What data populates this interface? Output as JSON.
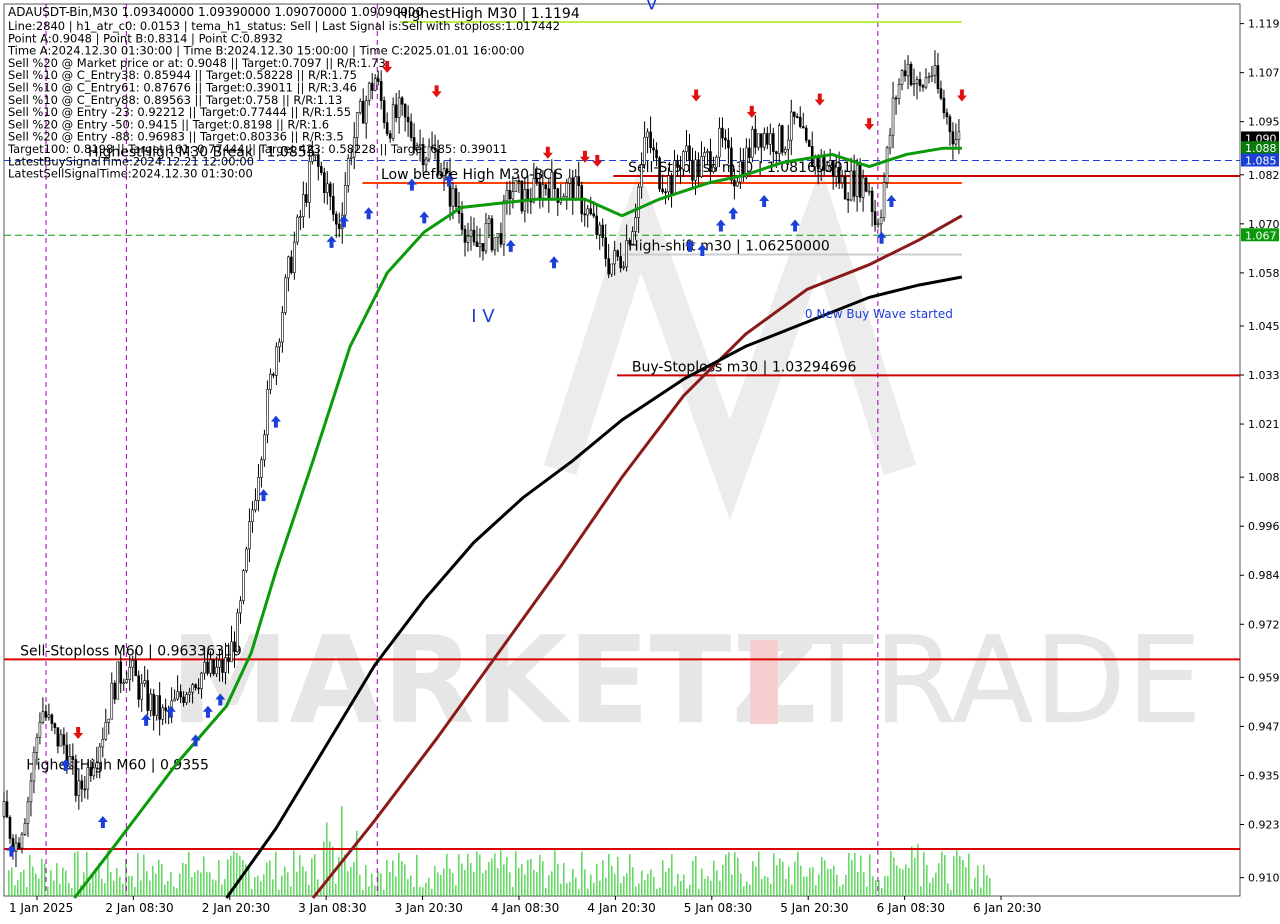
{
  "chart_data": {
    "type": "candlestick",
    "symbol_line": "ADAUSDT-Bin,M30  1.09340000 1.09390000 1.09070000 1.09090000",
    "info_lines": [
      "Line:2840 | h1_atr_c0: 0.0153 | tema_h1_status: Sell | Last Signal is:Sell with stoploss:1.017442",
      "Point A:0.9048 | Point B:0.8314 | Point C:0.8932",
      "Time A:2024.12.30 01:30:00 | Time B:2024.12.30 15:00:00 | Time C:2025.01.01 16:00:00",
      "Sell %20 @ Market price or at: 0.9048 || Target:0.7097 || R/R:1.73",
      "Sell %10 @ C_Entry38: 0.85944 || Target:0.58228 || R/R:1.75",
      "Sell %10 @ C_Entry61: 0.87676 || Target:0.39011 || R/R:3.46",
      "Sell %10 @ C_Entry88: 0.89563 || Target:0.758 || R/R:1.13",
      "Sell %10 @ Entry -23: 0.92212 || Target:0.77444 || R/R:1.55",
      "Sell %20 @ Entry -50: 0.9415 || Target:0.8198 || R/R:1.6",
      "Sell %20 @ Entry -88: 0.96983 || Target:0.80336 || R/R:3.5",
      "Target100: 0.8198 || Target 161: 0.77444 || Target 423: 0.58228 || Target 685: 0.39011",
      "LatestBuySignalTime:2024.12.21 12:00:00",
      "LatestSellSignalTime:2024.12.30 01:30:00"
    ],
    "y_axis": {
      "ticks": [
        "1.119",
        "1.107",
        "1.095",
        "1.082",
        "1.070",
        "1.058",
        "1.045",
        "1.033",
        "1.021",
        "1.008",
        "0.996",
        "0.984",
        "0.972",
        "0.959",
        "0.947",
        "0.935",
        "0.923",
        "0.910"
      ],
      "range": [
        0.9055,
        1.1238
      ]
    },
    "x_axis": {
      "ticks": [
        "1 Jan 2025",
        "2 Jan 08:30",
        "2 Jan 20:30",
        "3 Jan 08:30",
        "3 Jan 20:30",
        "4 Jan 08:30",
        "4 Jan 20:30",
        "5 Jan 08:30",
        "5 Jan 20:30",
        "6 Jan 08:30",
        "6 Jan 20:30"
      ]
    },
    "price_tags": [
      {
        "value": 1.0909,
        "text": "1.090",
        "bg": "#000000"
      },
      {
        "value": 1.0885,
        "text": "1.088",
        "bg": "#0a7a0a"
      },
      {
        "value": 1.0855,
        "text": "1.085",
        "bg": "#1c3fd8"
      },
      {
        "value": 1.0672,
        "text": "1.067",
        "bg": "#0a9a0a"
      }
    ],
    "levels": [
      {
        "label": "HighestHigh   M30 | 1.1194",
        "value": 1.1194,
        "color": "#b8f040",
        "x0": 0.32,
        "x1": 0.775,
        "label_x": 0.318
      },
      {
        "label": "Sell-Stoploss m30 | 1.08165301",
        "value": 1.0817,
        "color": "#cc0000",
        "x0": 0.493,
        "x1": 1.0,
        "label_x": 0.505
      },
      {
        "label": "Low before High   M30-BOS",
        "value": 1.08,
        "color": "#ff4000",
        "x0": 0.29,
        "x1": 0.775,
        "label_x": 0.305
      },
      {
        "label": "High-shift m30 | 1.06250000",
        "value": 1.0625,
        "color": "#cccccc",
        "x0": 0.5,
        "x1": 0.775,
        "label_x": 0.505
      },
      {
        "label": "Buy-Stoploss m30 | 1.03294696",
        "value": 1.0329,
        "color": "#cc0000",
        "x0": 0.496,
        "x1": 1.0,
        "label_x": 0.508
      },
      {
        "label": "Sell-Stoploss M60 | 0.96336319",
        "value": 0.9634,
        "color": "#dd0000",
        "x0": 0.0,
        "x1": 1.0,
        "label_x": 0.013
      },
      {
        "label": "HighestHigh   M60 | 0.9355",
        "value": 0.9355,
        "color": "#cccccc",
        "x0": 0.0,
        "x1": 0.0,
        "label_x": 0.018
      },
      {
        "label": "",
        "value": 0.917,
        "color": "#dd0000",
        "x0": 0.0,
        "x1": 1.0,
        "label_x": 0
      },
      {
        "label": "",
        "value": 1.0855,
        "color": "#1c3fd8",
        "x0": 0.0,
        "x1": 1.0,
        "label_x": 0,
        "dash": true
      },
      {
        "label": "",
        "value": 1.0672,
        "color": "#0a9a0a",
        "x0": 0.0,
        "x1": 1.0,
        "label_x": 0,
        "dash": true
      },
      {
        "label": "HighestHigh M30 Break | 1.0855",
        "value": 1.0855,
        "color": "#1c3fd8",
        "x0": 0.0,
        "x1": 0.0,
        "label_x": 0.068
      }
    ],
    "wave_labels": [
      {
        "text": "V",
        "t": 0.519,
        "value": 1.1225,
        "color": "#1c3fd8"
      },
      {
        "text": "I V",
        "t": 0.378,
        "value": 1.046,
        "color": "#1c3fd8"
      }
    ],
    "annotations": [
      {
        "text": "0 New Buy Wave started",
        "t": 0.648,
        "value": 1.047,
        "color": "#1c3fd8"
      }
    ],
    "watermark": [
      "MARKETZ",
      "I",
      "TRADE"
    ],
    "series": [
      {
        "name": "ema_fast",
        "color": "#0a9a0a",
        "points": [
          [
            0.057,
            0.905
          ],
          [
            0.09,
            0.918
          ],
          [
            0.14,
            0.938
          ],
          [
            0.18,
            0.952
          ],
          [
            0.2,
            0.965
          ],
          [
            0.22,
            0.985
          ],
          [
            0.25,
            1.012
          ],
          [
            0.28,
            1.04
          ],
          [
            0.31,
            1.058
          ],
          [
            0.34,
            1.068
          ],
          [
            0.37,
            1.074
          ],
          [
            0.4,
            1.075
          ],
          [
            0.43,
            1.076
          ],
          [
            0.47,
            1.076
          ],
          [
            0.5,
            1.072
          ],
          [
            0.53,
            1.076
          ],
          [
            0.57,
            1.08
          ],
          [
            0.6,
            1.082
          ],
          [
            0.63,
            1.085
          ],
          [
            0.67,
            1.087
          ],
          [
            0.7,
            1.084
          ],
          [
            0.73,
            1.087
          ],
          [
            0.76,
            1.0885
          ],
          [
            0.775,
            1.0885
          ]
        ]
      },
      {
        "name": "ma_slow",
        "color": "#8b1a1a",
        "points": [
          [
            0.25,
            0.905
          ],
          [
            0.3,
            0.924
          ],
          [
            0.35,
            0.944
          ],
          [
            0.4,
            0.965
          ],
          [
            0.45,
            0.986
          ],
          [
            0.5,
            1.008
          ],
          [
            0.55,
            1.028
          ],
          [
            0.6,
            1.043
          ],
          [
            0.65,
            1.054
          ],
          [
            0.7,
            1.06
          ],
          [
            0.74,
            1.066
          ],
          [
            0.775,
            1.072
          ]
        ]
      },
      {
        "name": "ma_black",
        "color": "#000000",
        "points": [
          [
            0.18,
            0.905
          ],
          [
            0.22,
            0.922
          ],
          [
            0.26,
            0.942
          ],
          [
            0.3,
            0.962
          ],
          [
            0.34,
            0.978
          ],
          [
            0.38,
            0.992
          ],
          [
            0.42,
            1.003
          ],
          [
            0.46,
            1.012
          ],
          [
            0.5,
            1.022
          ],
          [
            0.55,
            1.032
          ],
          [
            0.6,
            1.04
          ],
          [
            0.65,
            1.046
          ],
          [
            0.7,
            1.052
          ],
          [
            0.74,
            1.055
          ],
          [
            0.775,
            1.057
          ]
        ]
      }
    ],
    "price_path": [
      [
        0.0,
        0.925
      ],
      [
        0.01,
        0.918
      ],
      [
        0.02,
        0.93
      ],
      [
        0.03,
        0.952
      ],
      [
        0.04,
        0.945
      ],
      [
        0.05,
        0.942
      ],
      [
        0.06,
        0.93
      ],
      [
        0.07,
        0.938
      ],
      [
        0.08,
        0.946
      ],
      [
        0.09,
        0.958
      ],
      [
        0.1,
        0.962
      ],
      [
        0.11,
        0.956
      ],
      [
        0.12,
        0.952
      ],
      [
        0.13,
        0.949
      ],
      [
        0.14,
        0.953
      ],
      [
        0.15,
        0.958
      ],
      [
        0.16,
        0.96
      ],
      [
        0.17,
        0.96
      ],
      [
        0.18,
        0.962
      ],
      [
        0.19,
        0.972
      ],
      [
        0.2,
        0.998
      ],
      [
        0.21,
        1.02
      ],
      [
        0.22,
        1.04
      ],
      [
        0.23,
        1.058
      ],
      [
        0.24,
        1.072
      ],
      [
        0.25,
        1.086
      ],
      [
        0.26,
        1.08
      ],
      [
        0.27,
        1.068
      ],
      [
        0.28,
        1.088
      ],
      [
        0.29,
        1.098
      ],
      [
        0.3,
        1.106
      ],
      [
        0.31,
        1.094
      ],
      [
        0.32,
        1.097
      ],
      [
        0.33,
        1.092
      ],
      [
        0.34,
        1.088
      ],
      [
        0.35,
        1.087
      ],
      [
        0.36,
        1.078
      ],
      [
        0.37,
        1.072
      ],
      [
        0.38,
        1.063
      ],
      [
        0.39,
        1.068
      ],
      [
        0.4,
        1.066
      ],
      [
        0.41,
        1.079
      ],
      [
        0.42,
        1.076
      ],
      [
        0.43,
        1.078
      ],
      [
        0.44,
        1.08
      ],
      [
        0.45,
        1.078
      ],
      [
        0.46,
        1.079
      ],
      [
        0.47,
        1.074
      ],
      [
        0.48,
        1.068
      ],
      [
        0.49,
        1.06
      ],
      [
        0.5,
        1.062
      ],
      [
        0.51,
        1.072
      ],
      [
        0.52,
        1.092
      ],
      [
        0.53,
        1.082
      ],
      [
        0.54,
        1.08
      ],
      [
        0.55,
        1.088
      ],
      [
        0.56,
        1.083
      ],
      [
        0.57,
        1.086
      ],
      [
        0.58,
        1.09
      ],
      [
        0.59,
        1.082
      ],
      [
        0.6,
        1.086
      ],
      [
        0.61,
        1.093
      ],
      [
        0.62,
        1.091
      ],
      [
        0.63,
        1.09
      ],
      [
        0.64,
        1.095
      ],
      [
        0.65,
        1.087
      ],
      [
        0.66,
        1.085
      ],
      [
        0.67,
        1.084
      ],
      [
        0.68,
        1.079
      ],
      [
        0.69,
        1.081
      ],
      [
        0.7,
        1.079
      ],
      [
        0.705,
        1.07
      ],
      [
        0.71,
        1.075
      ],
      [
        0.72,
        1.1
      ],
      [
        0.73,
        1.11
      ],
      [
        0.74,
        1.102
      ],
      [
        0.75,
        1.108
      ],
      [
        0.76,
        1.098
      ],
      [
        0.77,
        1.091
      ],
      [
        0.775,
        1.0909
      ]
    ],
    "buy_arrows": [
      [
        0.006,
        0.921
      ],
      [
        0.05,
        0.942
      ],
      [
        0.08,
        0.928
      ],
      [
        0.115,
        0.953
      ],
      [
        0.135,
        0.955
      ],
      [
        0.155,
        0.948
      ],
      [
        0.165,
        0.955
      ],
      [
        0.175,
        0.958
      ],
      [
        0.21,
        1.008
      ],
      [
        0.22,
        1.026
      ],
      [
        0.265,
        1.07
      ],
      [
        0.275,
        1.075
      ],
      [
        0.295,
        1.077
      ],
      [
        0.33,
        1.084
      ],
      [
        0.34,
        1.076
      ],
      [
        0.36,
        1.085
      ],
      [
        0.41,
        1.069
      ],
      [
        0.445,
        1.065
      ],
      [
        0.555,
        1.069
      ],
      [
        0.565,
        1.068
      ],
      [
        0.58,
        1.074
      ],
      [
        0.59,
        1.077
      ],
      [
        0.615,
        1.08
      ],
      [
        0.64,
        1.074
      ],
      [
        0.71,
        1.071
      ],
      [
        0.718,
        1.08
      ]
    ],
    "sell_arrows": [
      [
        0.06,
        0.941
      ],
      [
        0.31,
        1.104
      ],
      [
        0.35,
        1.098
      ],
      [
        0.44,
        1.083
      ],
      [
        0.47,
        1.082
      ],
      [
        0.48,
        1.081
      ],
      [
        0.56,
        1.097
      ],
      [
        0.605,
        1.093
      ],
      [
        0.66,
        1.096
      ],
      [
        0.7,
        1.09
      ],
      [
        0.775,
        1.097
      ]
    ],
    "vlines": [
      0.034,
      0.099,
      0.302,
      0.707
    ]
  }
}
